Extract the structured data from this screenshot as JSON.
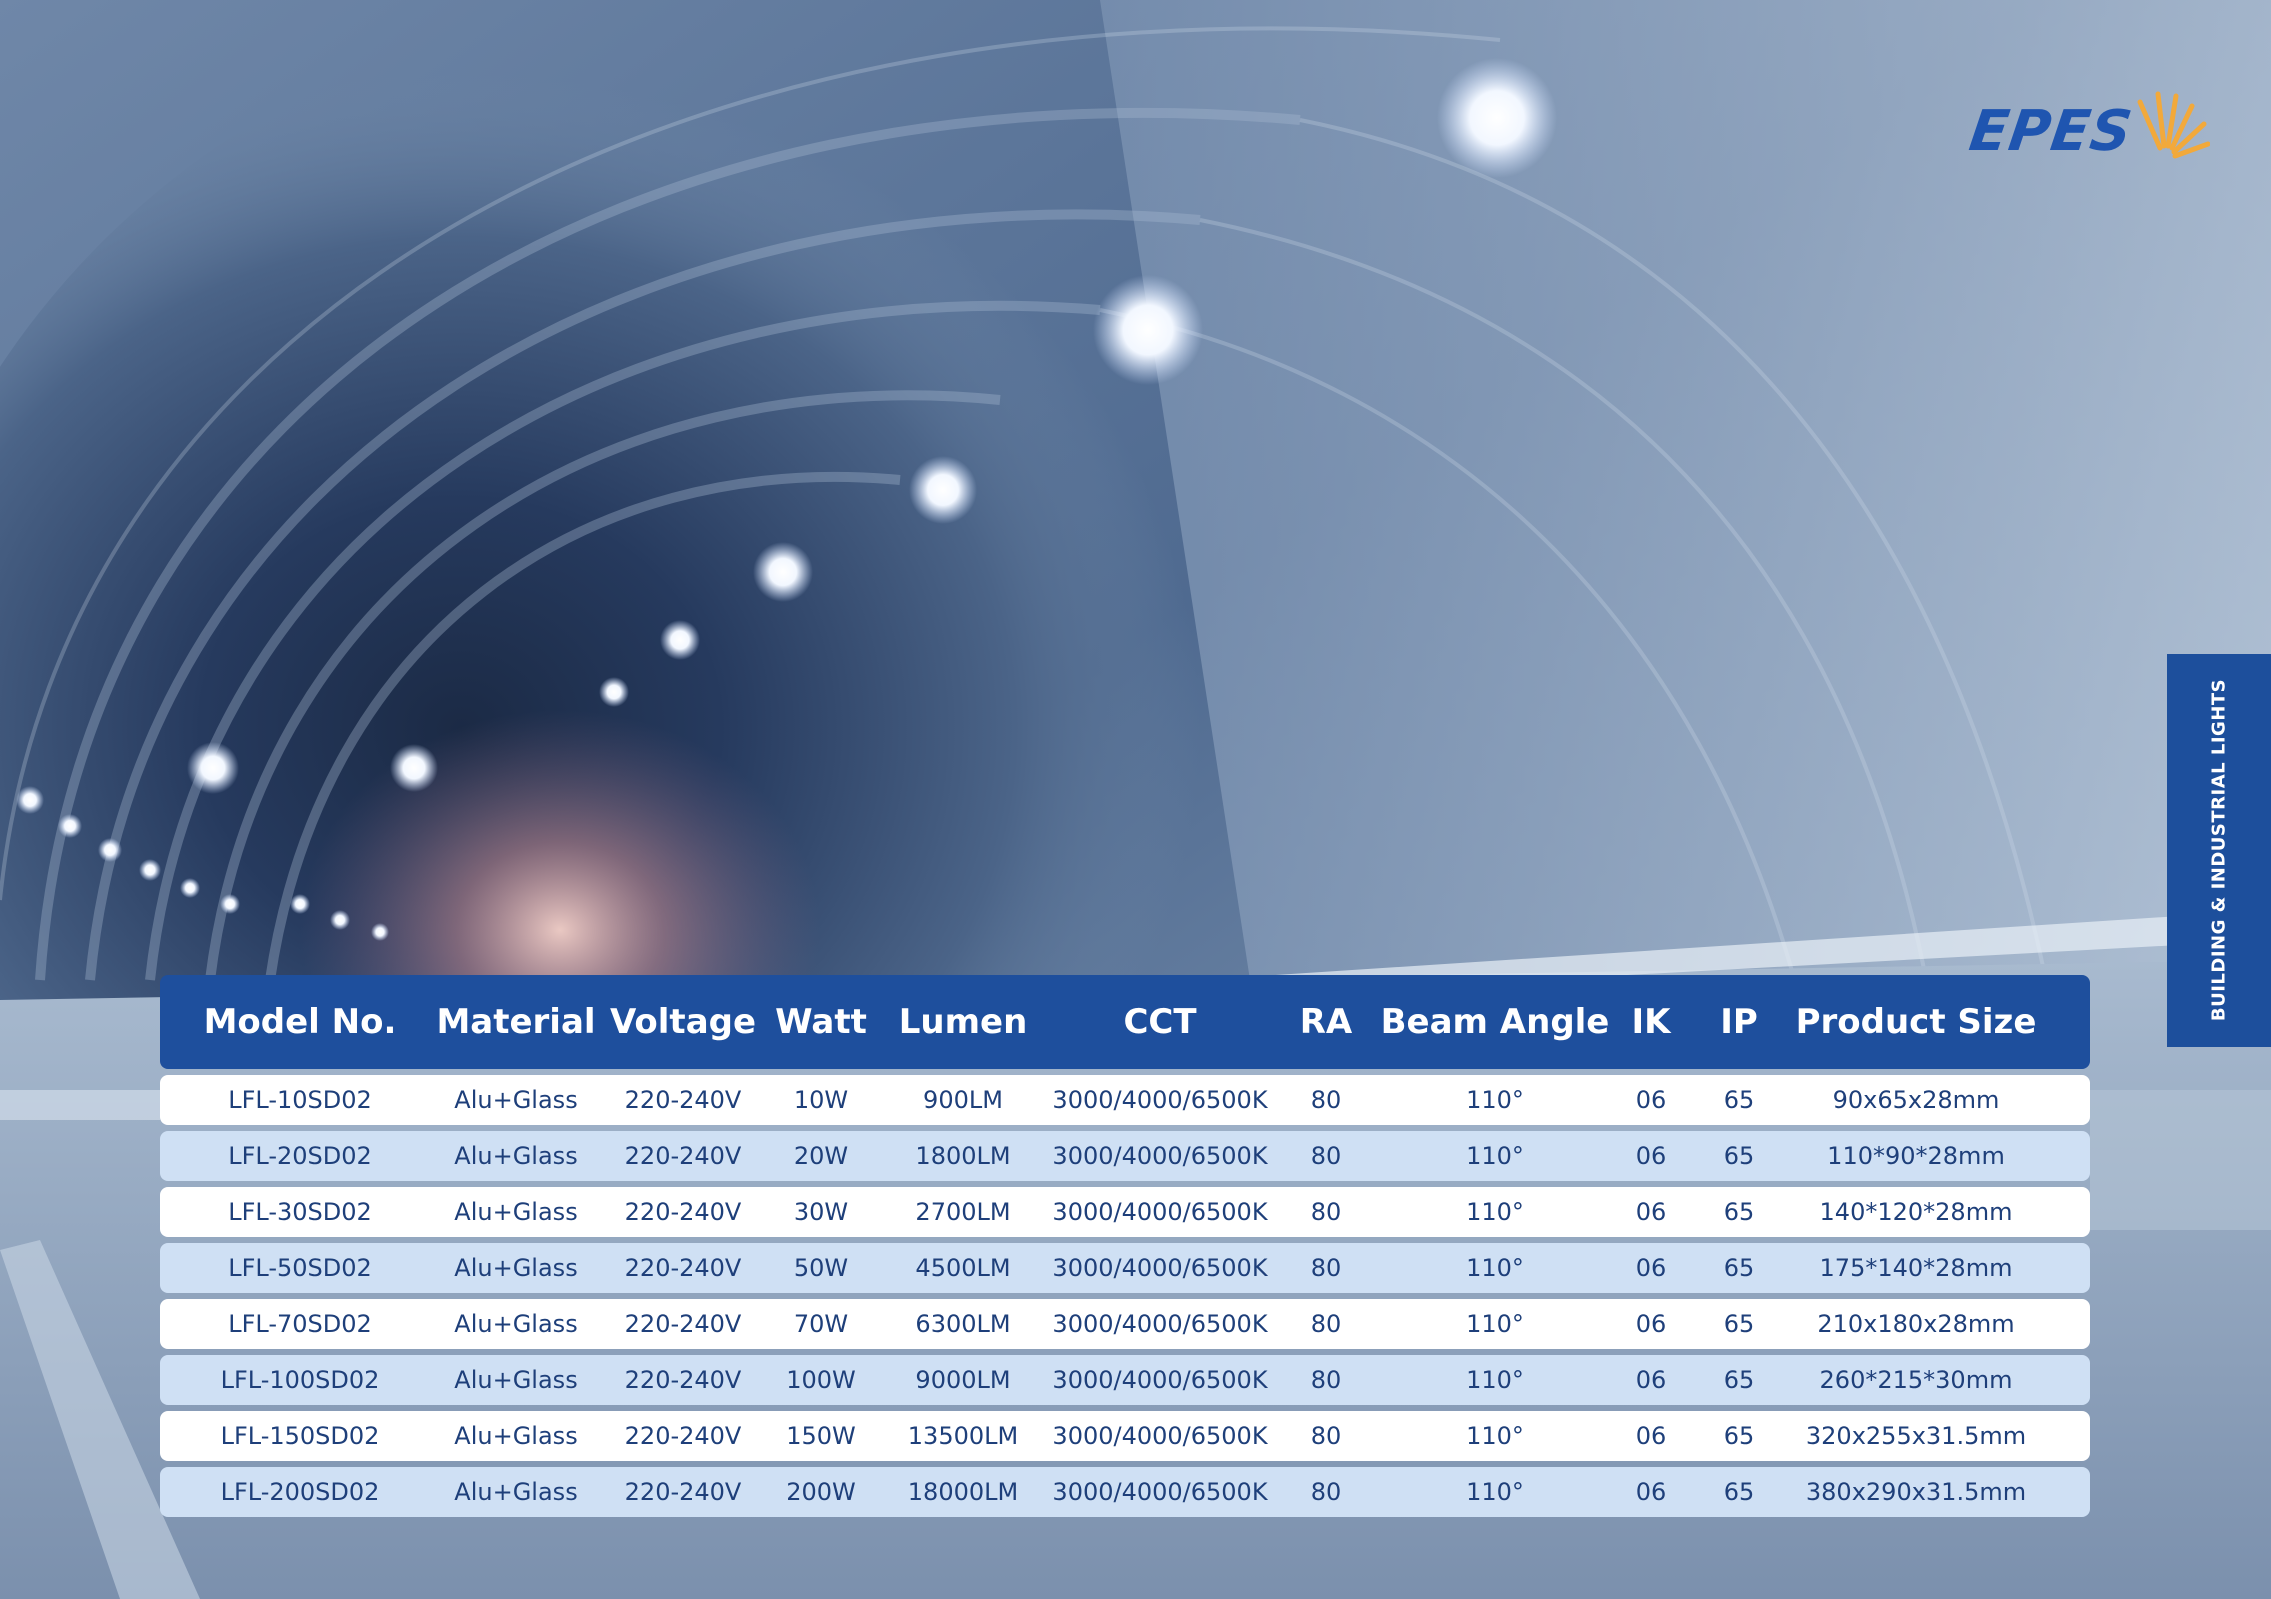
{
  "brand": {
    "logo_text": "EPES",
    "accent_color": "#f2a93b",
    "primary_color": "#1e4f9d"
  },
  "side_tab": {
    "label": "BUILDING & INDUSTRIAL LIGHTS"
  },
  "table": {
    "header_bg": "#1e4f9d",
    "row_colors": [
      "#ffffff",
      "#cfe0f4"
    ],
    "columns": [
      "Model No.",
      "Material",
      "Voltage",
      "Watt",
      "Lumen",
      "CCT",
      "RA",
      "Beam Angle",
      "IK",
      "IP",
      "Product Size"
    ],
    "rows": [
      [
        "LFL-10SD02",
        "Alu+Glass",
        "220-240V",
        "10W",
        "900LM",
        "3000/4000/6500K",
        "80",
        "110°",
        "06",
        "65",
        "90x65x28mm"
      ],
      [
        "LFL-20SD02",
        "Alu+Glass",
        "220-240V",
        "20W",
        "1800LM",
        "3000/4000/6500K",
        "80",
        "110°",
        "06",
        "65",
        "110*90*28mm"
      ],
      [
        "LFL-30SD02",
        "Alu+Glass",
        "220-240V",
        "30W",
        "2700LM",
        "3000/4000/6500K",
        "80",
        "110°",
        "06",
        "65",
        "140*120*28mm"
      ],
      [
        "LFL-50SD02",
        "Alu+Glass",
        "220-240V",
        "50W",
        "4500LM",
        "3000/4000/6500K",
        "80",
        "110°",
        "06",
        "65",
        "175*140*28mm"
      ],
      [
        "LFL-70SD02",
        "Alu+Glass",
        "220-240V",
        "70W",
        "6300LM",
        "3000/4000/6500K",
        "80",
        "110°",
        "06",
        "65",
        "210x180x28mm"
      ],
      [
        "LFL-100SD02",
        "Alu+Glass",
        "220-240V",
        "100W",
        "9000LM",
        "3000/4000/6500K",
        "80",
        "110°",
        "06",
        "65",
        "260*215*30mm"
      ],
      [
        "LFL-150SD02",
        "Alu+Glass",
        "220-240V",
        "150W",
        "13500LM",
        "3000/4000/6500K",
        "80",
        "110°",
        "06",
        "65",
        "320x255x31.5mm"
      ],
      [
        "LFL-200SD02",
        "Alu+Glass",
        "220-240V",
        "200W",
        "18000LM",
        "3000/4000/6500K",
        "80",
        "110°",
        "06",
        "65",
        "380x290x31.5mm"
      ]
    ]
  }
}
